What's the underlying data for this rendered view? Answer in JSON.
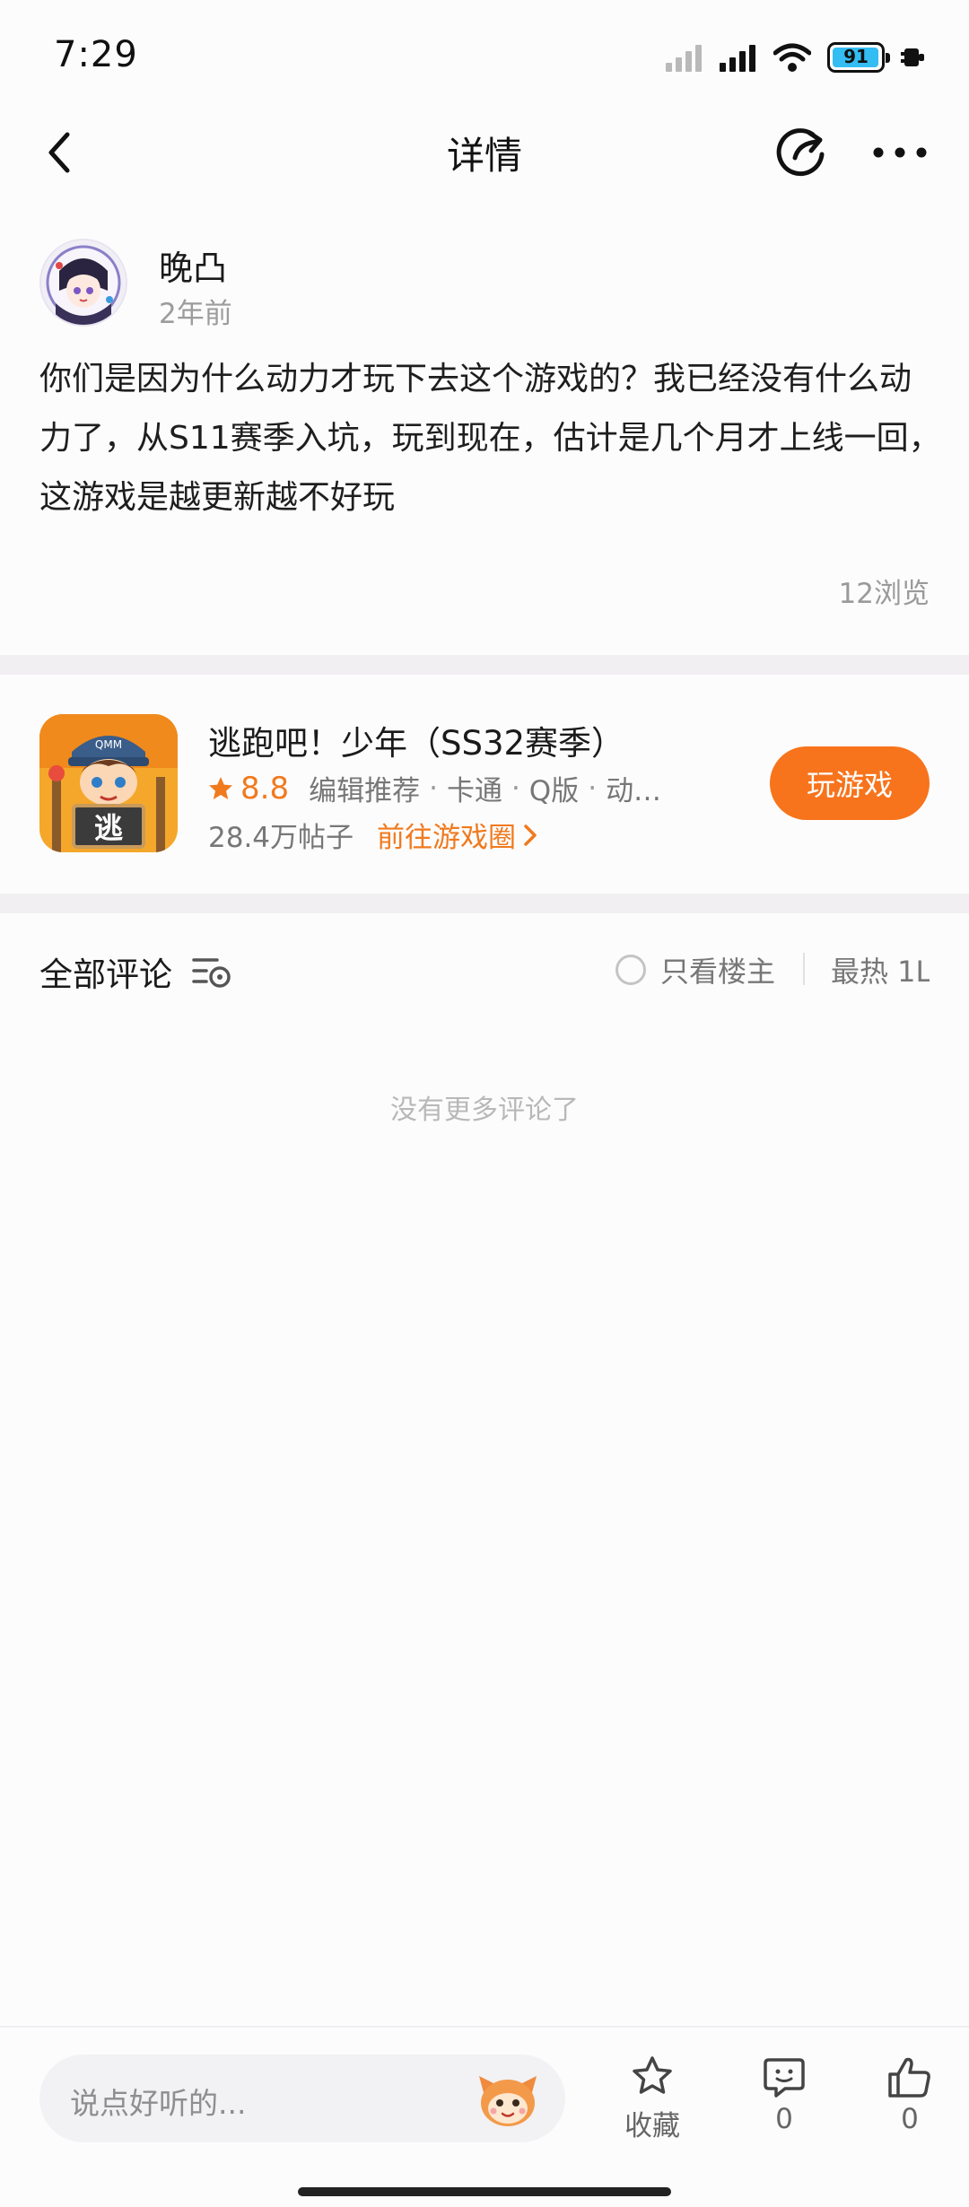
{
  "status_bar": {
    "time": "7:29",
    "battery": "91"
  },
  "nav": {
    "title": "详情"
  },
  "post": {
    "author": "晚凸",
    "time": "2年前",
    "body": "你们是因为什么动力才玩下去这个游戏的？我已经没有什么动力了，从S11赛季入坑，玩到现在，估计是几个月才上线一回，这游戏是越更新越不好玩",
    "views": "12浏览"
  },
  "game": {
    "name": "逃跑吧！少年（SS32赛季）",
    "rating": "8.8",
    "tags": [
      "编辑推荐",
      "卡通",
      "Q版",
      "动…"
    ],
    "post_count": "28.4万帖子",
    "goto_label": "前往游戏圈",
    "play_label": "玩游戏",
    "icon_text": "逃",
    "hat_text": "QMM"
  },
  "comments": {
    "title": "全部评论",
    "only_op_label": "只看楼主",
    "sort_label": "最热 1L",
    "empty_text": "没有更多评论了"
  },
  "bottom": {
    "input_placeholder": "说点好听的...",
    "favorite_label": "收藏",
    "comment_count": "0",
    "like_count": "0"
  },
  "colors": {
    "accent": "#f7741c",
    "rating": "#f07a1e",
    "battery": "#33bdf2"
  }
}
